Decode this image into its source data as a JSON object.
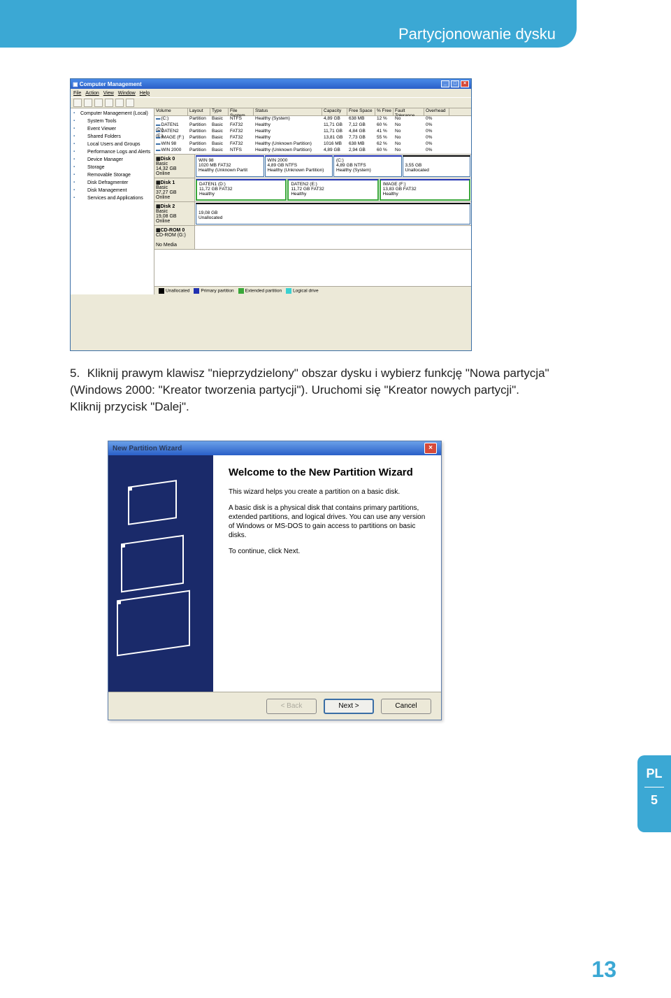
{
  "header": {
    "title": "Partycjonowanie dysku"
  },
  "cm": {
    "window_title": "Computer Management",
    "menu": [
      "File",
      "Action",
      "View",
      "Window",
      "Help"
    ],
    "tree": [
      "Computer Management (Local)",
      "System Tools",
      "Event Viewer",
      "Shared Folders",
      "Local Users and Groups",
      "Performance Logs and Alerts",
      "Device Manager",
      "Storage",
      "Removable Storage",
      "Disk Defragmenter",
      "Disk Management",
      "Services and Applications"
    ],
    "vol_headers": [
      "Volume",
      "Layout",
      "Type",
      "File System",
      "Status",
      "Capacity",
      "Free Space",
      "% Free",
      "Fault Tolerance",
      "Overhead"
    ],
    "volumes": [
      {
        "vol": "(C:)",
        "layout": "Partition",
        "type": "Basic",
        "fs": "NTFS",
        "status": "Healthy (System)",
        "cap": "4,89 GB",
        "free": "638 MB",
        "pct": "12 %",
        "ft": "No",
        "ov": "0%"
      },
      {
        "vol": "DATEN1 (D:)",
        "layout": "Partition",
        "type": "Basic",
        "fs": "FAT32",
        "status": "Healthy",
        "cap": "11,71 GB",
        "free": "7,12 GB",
        "pct": "60 %",
        "ft": "No",
        "ov": "0%"
      },
      {
        "vol": "DATEN2 (E:)",
        "layout": "Partition",
        "type": "Basic",
        "fs": "FAT32",
        "status": "Healthy",
        "cap": "11,71 GB",
        "free": "4,84 GB",
        "pct": "41 %",
        "ft": "No",
        "ov": "0%"
      },
      {
        "vol": "IMAGE (F:)",
        "layout": "Partition",
        "type": "Basic",
        "fs": "FAT32",
        "status": "Healthy",
        "cap": "13,81 GB",
        "free": "7,73 GB",
        "pct": "55 %",
        "ft": "No",
        "ov": "0%"
      },
      {
        "vol": "WIN 98",
        "layout": "Partition",
        "type": "Basic",
        "fs": "FAT32",
        "status": "Healthy (Unknown Partition)",
        "cap": "1016 MB",
        "free": "638 MB",
        "pct": "62 %",
        "ft": "No",
        "ov": "0%"
      },
      {
        "vol": "WIN 2000",
        "layout": "Partition",
        "type": "Basic",
        "fs": "NTFS",
        "status": "Healthy (Unknown Partition)",
        "cap": "4,89 GB",
        "free": "2,94 GB",
        "pct": "60 %",
        "ft": "No",
        "ov": "0%"
      }
    ],
    "disks": [
      {
        "label": "Disk 0",
        "sub": "Basic\n14,32 GB\nOnline",
        "parts": [
          {
            "cls": "blue",
            "t": "WIN 98\n1020 MB FAT32\nHealthy (Unknown Partit"
          },
          {
            "cls": "blue",
            "t": "WIN 2000\n4,89 GB NTFS\nHealthy (Unknown Partition)"
          },
          {
            "cls": "blue",
            "t": "(C:)\n4,89 GB NTFS\nHealthy (System)"
          },
          {
            "cls": "black",
            "t": "\n3,55 GB\nUnallocated"
          }
        ]
      },
      {
        "label": "Disk 1",
        "sub": "Basic\n37,27 GB\nOnline",
        "parts": [
          {
            "cls": "green",
            "t": "DATEN1 (D:)\n11,72 GB FAT32\nHealthy"
          },
          {
            "cls": "green",
            "t": "DATEN2 (E:)\n11,72 GB FAT32\nHealthy"
          },
          {
            "cls": "green",
            "t": "IMAGE (F:)\n13,83 GB FAT32\nHealthy"
          }
        ]
      },
      {
        "label": "Disk 2",
        "sub": "Basic\n19,08 GB\nOnline",
        "parts": [
          {
            "cls": "black",
            "t": "\n19,08 GB\nUnallocated"
          }
        ]
      },
      {
        "label": "CD-ROM 0",
        "sub": "CD-ROM (G:)\n\nNo Media",
        "parts": []
      }
    ],
    "legend": [
      {
        "cls": "black",
        "t": "Unallocated"
      },
      {
        "cls": "blue",
        "t": "Primary partition"
      },
      {
        "cls": "green",
        "t": "Extended partition"
      },
      {
        "cls": "cyan",
        "t": "Logical drive"
      }
    ]
  },
  "body": {
    "num": "5.",
    "text": "Kliknij prawym klawisz \"nieprzydzielony\" obszar dysku i wybierz funkcję \"Nowa partycja\" (Windows 2000: \"Kreator tworzenia partycji\"). Uruchomi się \"Kreator nowych partycji\". Kliknij przycisk \"Dalej\"."
  },
  "wizard": {
    "title": "New Partition Wizard",
    "heading": "Welcome to the New Partition Wizard",
    "p1": "This wizard helps you create a partition on a basic disk.",
    "p2": "A basic disk is a physical disk that contains primary partitions, extended partitions, and logical drives. You can use any version of Windows or MS-DOS to gain access to partitions on basic disks.",
    "p3": "To continue, click Next.",
    "back": "< Back",
    "next": "Next >",
    "cancel": "Cancel"
  },
  "side": {
    "lang": "PL",
    "chap": "5"
  },
  "page_number": "13"
}
